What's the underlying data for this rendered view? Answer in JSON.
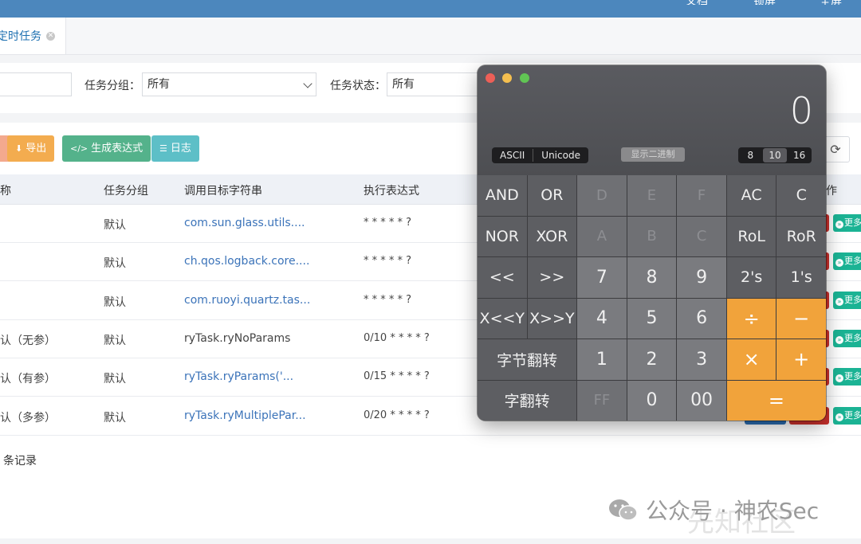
{
  "topbar": {
    "items": [
      "文档",
      "锁屏",
      "全屏"
    ]
  },
  "tabs": [
    {
      "label": "定时任务"
    }
  ],
  "search": {
    "group_label": "任务分组：",
    "group_value": "所有",
    "status_label": "任务状态：",
    "status_value": "所有"
  },
  "toolbar": {
    "export_label": "导出",
    "cron_label": "生成表达式",
    "log_label": "日志"
  },
  "table": {
    "headers": [
      "称",
      "任务分组",
      "调用目标字符串",
      "执行表达式",
      "作"
    ],
    "rows": [
      {
        "name": "",
        "group": "默认",
        "target": "com.sun.glass.utils....",
        "cron": "* * * * * ?",
        "target_link": true
      },
      {
        "name": "",
        "group": "默认",
        "target": "ch.qos.logback.core....",
        "cron": "* * * * * ?",
        "target_link": true
      },
      {
        "name": "",
        "group": "默认",
        "target": "com.ruoyi.quartz.tas...",
        "cron": "* * * * * ?",
        "target_link": true
      },
      {
        "name": "认（无参）",
        "group": "默认",
        "target": "ryTask.ryNoParams",
        "cron": "0/10 * * * * ?",
        "target_link": false
      },
      {
        "name": "认（有参）",
        "group": "默认",
        "target": "ryTask.ryParams('...",
        "cron": "0/15 * * * * ?",
        "target_link": true
      },
      {
        "name": "认（多参）",
        "group": "默认",
        "target": "ryTask.ryMultiplePar...",
        "cron": "0/20 * * * * ?",
        "target_link": true
      }
    ],
    "row_action_label": "更多",
    "footer": "条记录"
  },
  "watermark": {
    "text": "公众号 · 神农Sec",
    "ghost": "先知社区"
  },
  "calculator": {
    "display": "0",
    "mode_ascii": "ASCII",
    "mode_unicode": "Unicode",
    "binary_toggle": "显示二进制",
    "bases": [
      "8",
      "10",
      "16"
    ],
    "active_base": "10",
    "keys": [
      [
        "AND",
        "OR",
        "D",
        "E",
        "F",
        "AC",
        "C"
      ],
      [
        "NOR",
        "XOR",
        "A",
        "B",
        "C",
        "RoL",
        "RoR"
      ],
      [
        "<<",
        ">>",
        "7",
        "8",
        "9",
        "2's",
        "1's"
      ],
      [
        "X<<Y",
        "X>>Y",
        "4",
        "5",
        "6",
        "÷",
        "−"
      ],
      [
        "字节翻转",
        "1",
        "2",
        "3",
        "×",
        "+"
      ],
      [
        "字翻转",
        "FF",
        "0",
        "00",
        "="
      ]
    ],
    "colors": {
      "operator": "#f1a33b",
      "close": "#ed5f57",
      "minimize": "#f5bf4f",
      "zoom": "#61c554"
    }
  }
}
